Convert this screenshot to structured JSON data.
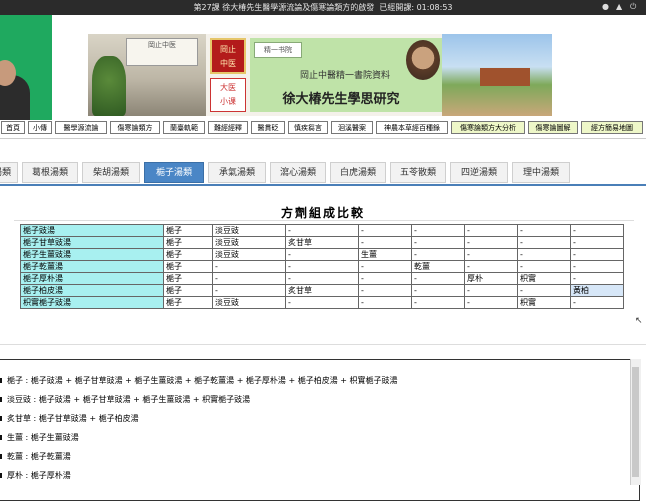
{
  "session_bar": {
    "title": "第27課 徐大椿先生醫學源流論及傷寒論類方的啟發",
    "elapsed": "已經開課: 01:08:53",
    "controls": [
      "person-icon",
      "volume-icon",
      "power-icon"
    ]
  },
  "banner": {
    "sign_text": "岡止中医",
    "red_logo_text": "岡止\n中医",
    "small_logo_text": "大医\n小课",
    "brand": "精一书院",
    "subtitle": "岡止中醫精一書院資料",
    "main_title": "徐大椿先生學思研究"
  },
  "nav": {
    "items": [
      "首頁",
      "小傳",
      "醫學源流論",
      "傷寒論類方",
      "蘭臺軌範",
      "難經經釋",
      "醫貫砭",
      "慎疾芻言",
      "洄溪醫案",
      "神農本草經百種錄",
      "傷寒論類方大分析",
      "傷寒論圖解",
      "經方簡易地圖"
    ]
  },
  "tabs": [
    {
      "label": "湯類"
    },
    {
      "label": "葛根湯類"
    },
    {
      "label": "柴胡湯類"
    },
    {
      "label": "梔子湯類",
      "active": true
    },
    {
      "label": "承氣湯類"
    },
    {
      "label": "瀉心湯類"
    },
    {
      "label": "白虎湯類"
    },
    {
      "label": "五苓散類"
    },
    {
      "label": "四逆湯類"
    },
    {
      "label": "理中湯類"
    }
  ],
  "comparison": {
    "title": "方劑組成比較",
    "rows": [
      [
        "梔子豉湯",
        "梔子",
        "淡豆豉",
        "-",
        "-",
        "-",
        "-",
        "-",
        "-"
      ],
      [
        "梔子甘草豉湯",
        "梔子",
        "淡豆豉",
        "炙甘草",
        "-",
        "-",
        "-",
        "-",
        "-"
      ],
      [
        "梔子生薑豉湯",
        "梔子",
        "淡豆豉",
        "-",
        "生薑",
        "-",
        "-",
        "-",
        "-"
      ],
      [
        "梔子乾薑湯",
        "梔子",
        "-",
        "-",
        "-",
        "乾薑",
        "-",
        "-",
        "-"
      ],
      [
        "梔子厚朴湯",
        "梔子",
        "-",
        "-",
        "-",
        "-",
        "厚朴",
        "枳實",
        "-"
      ],
      [
        "梔子柏皮湯",
        "梔子",
        "-",
        "炙甘草",
        "-",
        "-",
        "-",
        "-",
        "黃柏"
      ],
      [
        "枳實梔子豉湯",
        "梔子",
        "淡豆豉",
        "-",
        "-",
        "-",
        "-",
        "枳實",
        "-"
      ]
    ],
    "highlight_cell": "黃柏"
  },
  "herb_index": [
    {
      "herb": "梔子",
      "formulas": "梔子豉湯 + 梔子甘草豉湯 + 梔子生薑豉湯 + 梔子乾薑湯 + 梔子厚朴湯 + 梔子柏皮湯 + 枳實梔子豉湯"
    },
    {
      "herb": "淡豆豉",
      "formulas": "梔子豉湯 + 梔子甘草豉湯 + 梔子生薑豉湯 + 枳實梔子豉湯"
    },
    {
      "herb": "炙甘草",
      "formulas": "梔子甘草豉湯 + 梔子柏皮湯"
    },
    {
      "herb": "生薑",
      "formulas": "梔子生薑豉湯"
    },
    {
      "herb": "乾薑",
      "formulas": "梔子乾薑湯"
    },
    {
      "herb": "厚朴",
      "formulas": "梔子厚朴湯"
    }
  ]
}
